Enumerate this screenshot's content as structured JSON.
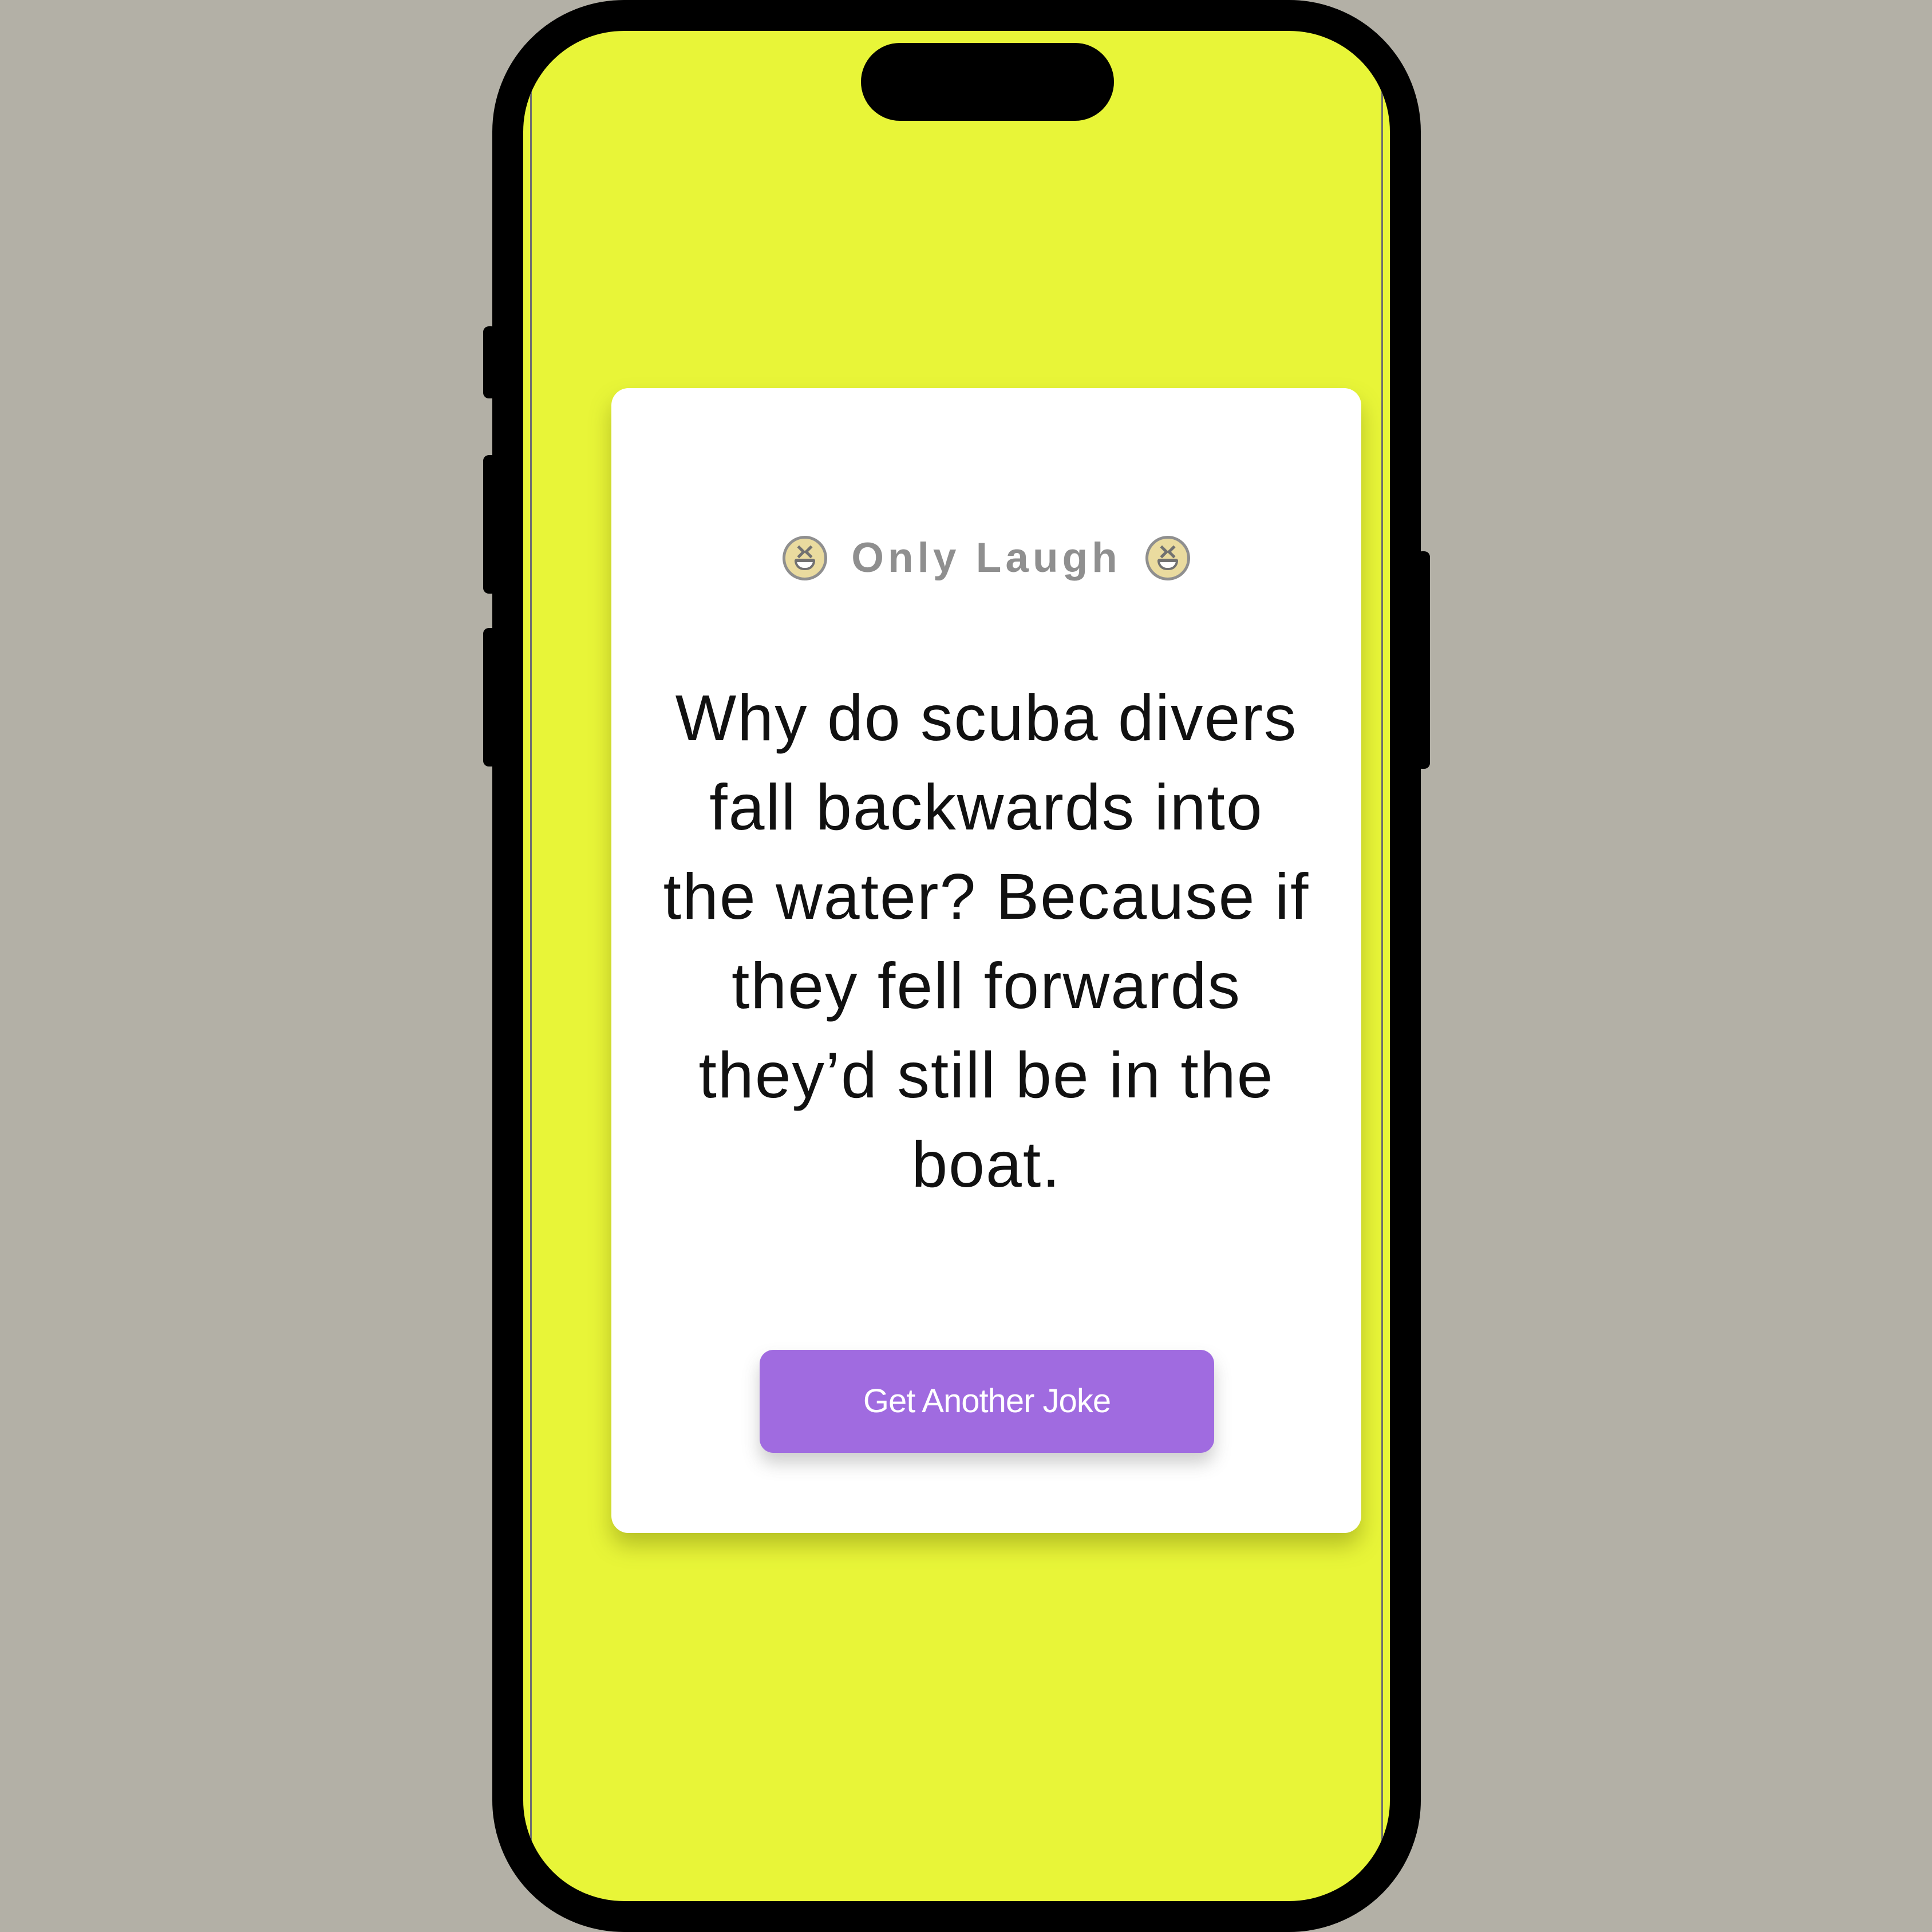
{
  "app": {
    "brand_name": "Only Laugh",
    "emoji_icon": "laughing-face-icon",
    "joke_text": "Why do scuba divers fall backwards into the water? Because if they fell forwards they’d still be in the boat.",
    "button_label": "Get Another Joke"
  },
  "colors": {
    "page_background": "#b3b0a6",
    "screen_background": "#e8f538",
    "card_background": "#ffffff",
    "button_background": "#a06be0",
    "brand_text": "#8f8f8f",
    "joke_text": "#111111"
  }
}
